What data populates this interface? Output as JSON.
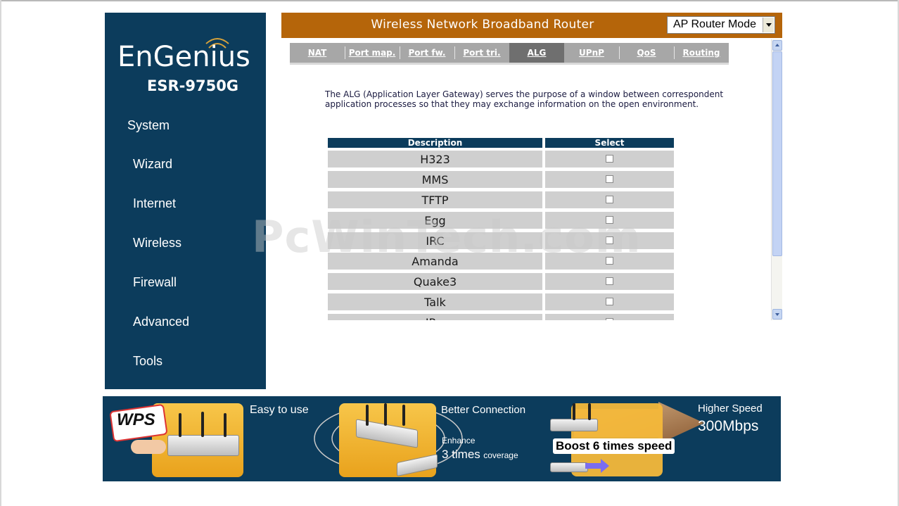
{
  "brand": {
    "logo": "EnGenius",
    "model": "ESR-9750G"
  },
  "nav": {
    "items": [
      "System",
      "Wizard",
      "Internet",
      "Wireless",
      "Firewall",
      "Advanced",
      "Tools"
    ]
  },
  "header": {
    "title": "Wireless Network Broadband Router",
    "mode_selected": "AP Router Mode"
  },
  "tabs": [
    {
      "label": "NAT"
    },
    {
      "label": "Port map."
    },
    {
      "label": "Port fw."
    },
    {
      "label": "Port tri."
    },
    {
      "label": "ALG",
      "active": true
    },
    {
      "label": "UPnP"
    },
    {
      "label": "QoS"
    },
    {
      "label": "Routing"
    }
  ],
  "content": {
    "description": "The ALG (Application Layer Gateway) serves the purpose of a window between correspondent application processes so that they may exchange information on the open environment.",
    "table": {
      "headers": [
        "Description",
        "Select"
      ],
      "rows": [
        {
          "name": "H323",
          "checked": false
        },
        {
          "name": "MMS",
          "checked": false
        },
        {
          "name": "TFTP",
          "checked": false
        },
        {
          "name": "Egg",
          "checked": false
        },
        {
          "name": "IRC",
          "checked": false
        },
        {
          "name": "Amanda",
          "checked": false
        },
        {
          "name": "Quake3",
          "checked": false
        },
        {
          "name": "Talk",
          "checked": false
        },
        {
          "name": "IP...",
          "checked": false
        }
      ]
    }
  },
  "watermark": "PcWinTech.com",
  "banner": {
    "wps_label": "WPS",
    "easy": "Easy to use",
    "better": "Better Connection",
    "enhance": "Enhance",
    "coverage_big": "3 times",
    "coverage_small": "coverage",
    "boost": "Boost 6 times speed",
    "higher": "Higher Speed",
    "speed": "300Mbps"
  },
  "colors": {
    "sidebar": "#0c3c5c",
    "header": "#b5650a",
    "tab_bar": "#a7a7a7",
    "tab_active": "#6f6f6f",
    "row": "#cfcfcf"
  }
}
